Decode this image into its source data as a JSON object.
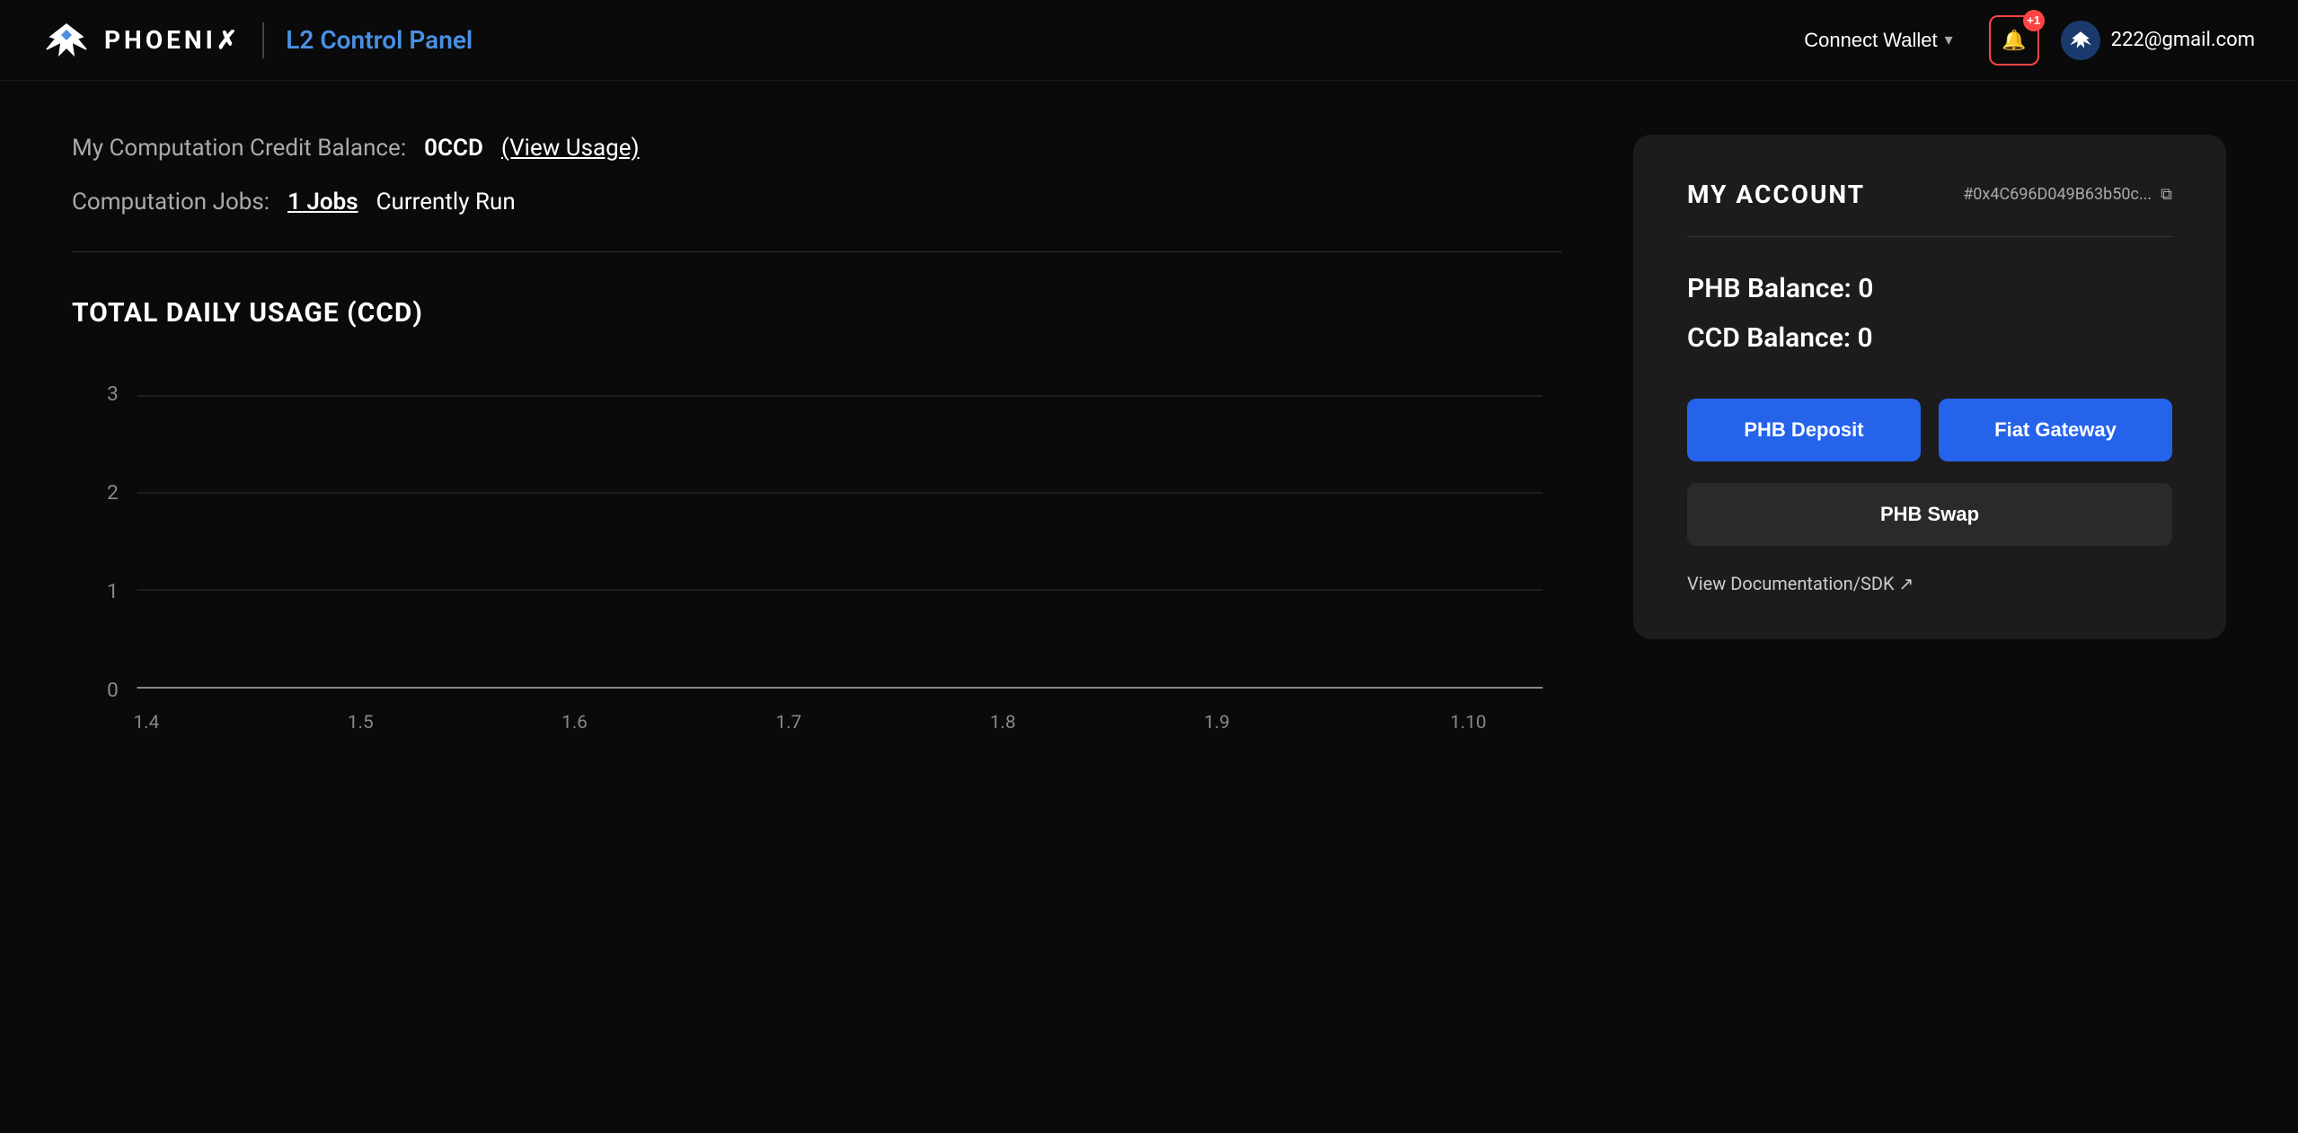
{
  "header": {
    "logo_text": "PHOENI✗",
    "page_title": "L2 Control Panel",
    "connect_wallet_label": "Connect Wallet",
    "notification_badge": "+1",
    "user_email": "222@gmail.com"
  },
  "balance": {
    "label": "My Computation Credit Balance:",
    "value": "0CCD",
    "view_usage": "(View Usage)"
  },
  "jobs": {
    "label": "Computation Jobs:",
    "link": "1 Jobs",
    "running": "Currently Run"
  },
  "chart": {
    "title": "TOTAL DAILY USAGE (CCD)",
    "y_labels": [
      "3",
      "2",
      "1",
      "0"
    ],
    "x_labels": [
      "1.4",
      "1.5",
      "1.6",
      "1.7",
      "1.8",
      "1.9",
      "1.10"
    ]
  },
  "account": {
    "title": "MY ACCOUNT",
    "address": "#0x4C696D049B63b50c...",
    "phb_balance": "PHB Balance: 0",
    "ccd_balance": "CCD Balance: 0",
    "phb_deposit_btn": "PHB Deposit",
    "fiat_gateway_btn": "Fiat Gateway",
    "phb_swap_btn": "PHB Swap",
    "view_docs_label": "View Documentation/SDK ↗"
  }
}
